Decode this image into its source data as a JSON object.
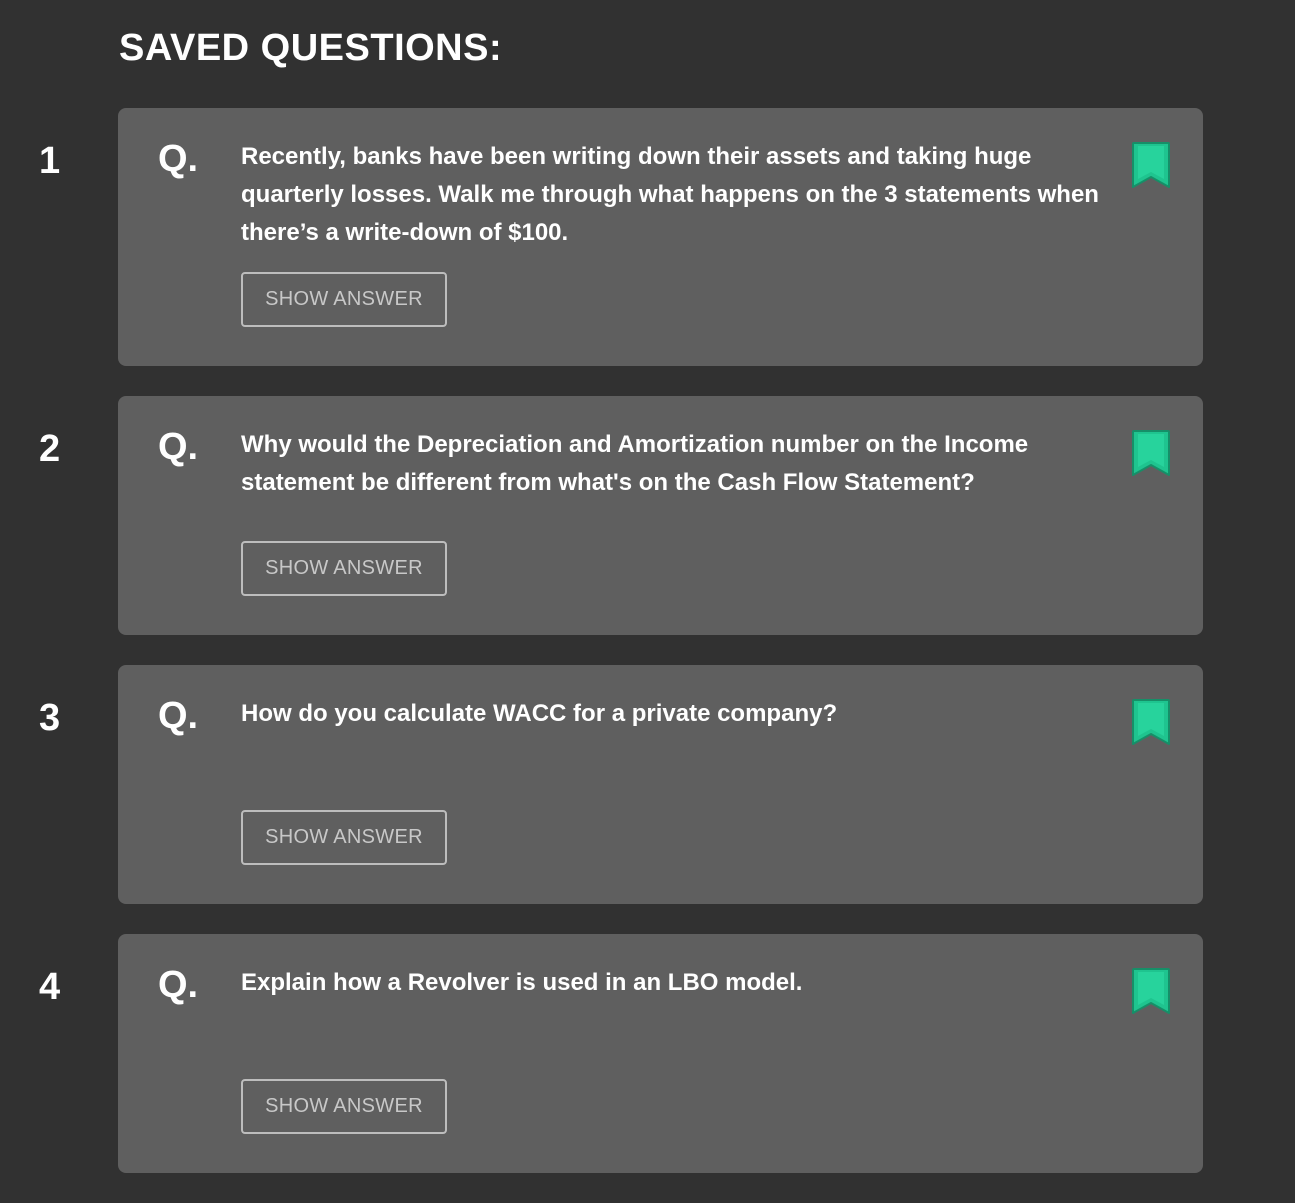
{
  "page": {
    "title": "SAVED QUESTIONS:"
  },
  "questions": [
    {
      "number": "1",
      "marker": "Q.",
      "text": "Recently, banks have been writing down their assets and taking huge quarterly losses. Walk me through what happens on the 3 statements when there’s a write-down of $100.",
      "button_label": "SHOW ANSWER",
      "bookmark_icon": "bookmark-icon"
    },
    {
      "number": "2",
      "marker": "Q.",
      "text": "Why would the Depreciation and Amortization number on the Income statement be different from what's on the Cash Flow Statement?",
      "button_label": "SHOW ANSWER",
      "bookmark_icon": "bookmark-icon"
    },
    {
      "number": "3",
      "marker": "Q.",
      "text": "How do you calculate WACC for a private company?",
      "button_label": "SHOW ANSWER",
      "bookmark_icon": "bookmark-icon"
    },
    {
      "number": "4",
      "marker": "Q.",
      "text": "Explain how a Revolver is used in an LBO model.",
      "button_label": "SHOW ANSWER",
      "bookmark_icon": "bookmark-icon"
    }
  ],
  "colors": {
    "background": "#313131",
    "card": "#5f5f5f",
    "bookmark": "#1fc48f"
  }
}
